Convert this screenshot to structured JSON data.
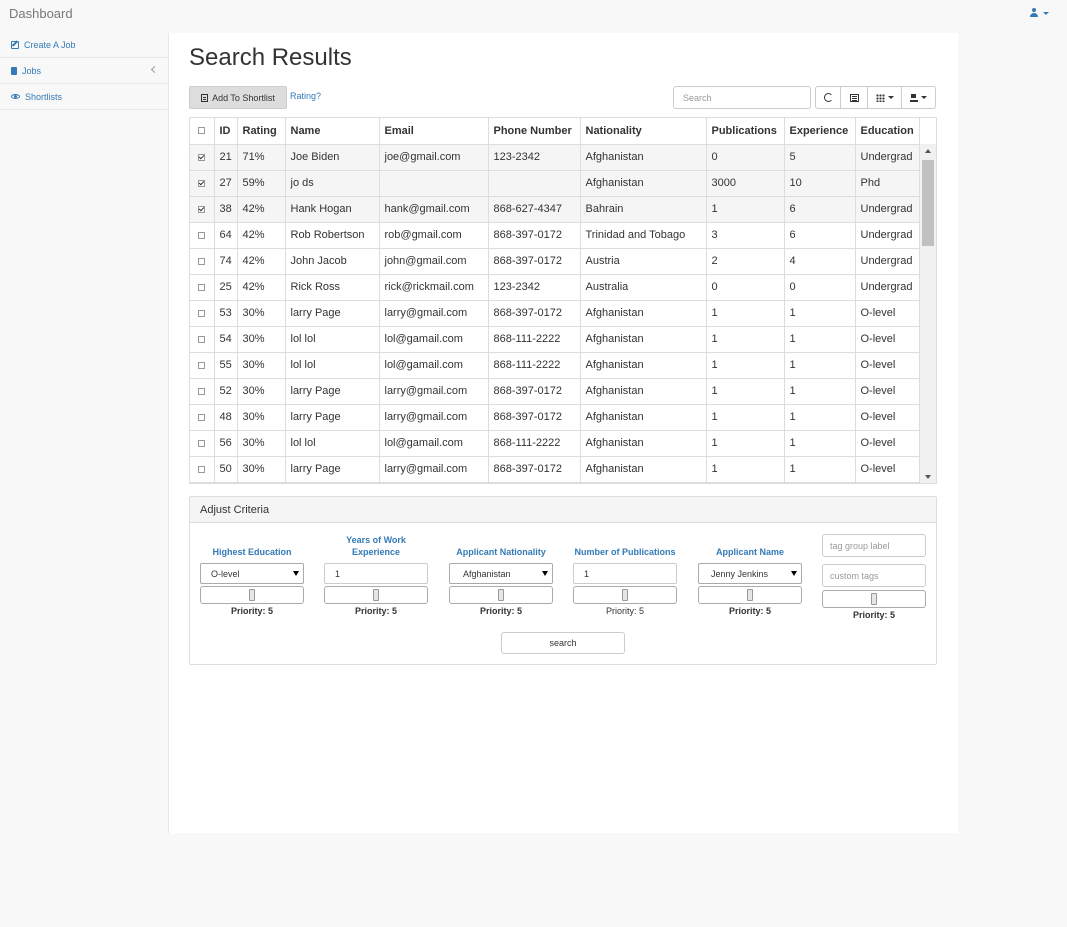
{
  "header": {
    "brand": "Dashboard",
    "user_icon": "user-icon"
  },
  "sidebar": {
    "items": [
      {
        "label": "Create A Job",
        "icon": "edit-icon"
      },
      {
        "label": "Jobs",
        "icon": "book-icon"
      },
      {
        "label": "Shortlists",
        "icon": "eye-icon"
      }
    ]
  },
  "page": {
    "title": "Search Results"
  },
  "toolbar": {
    "add_shortlist": "Add To Shortlist",
    "rating_link": "Rating?",
    "search_placeholder": "Search"
  },
  "table": {
    "columns": [
      "ID",
      "Rating",
      "Name",
      "Email",
      "Phone Number",
      "Nationality",
      "Publications",
      "Experience",
      "Education"
    ],
    "rows": [
      {
        "checked": true,
        "cells": [
          "21",
          "71%",
          "Joe Biden",
          "joe@gmail.com",
          "123-2342",
          "Afghanistan",
          "0",
          "5",
          "Undergrad"
        ]
      },
      {
        "checked": true,
        "cells": [
          "27",
          "59%",
          "jo ds",
          "",
          "",
          "Afghanistan",
          "3000",
          "10",
          "Phd"
        ]
      },
      {
        "checked": true,
        "cells": [
          "38",
          "42%",
          "Hank Hogan",
          "hank@gmail.com",
          "868-627-4347",
          "Bahrain",
          "1",
          "6",
          "Undergrad"
        ]
      },
      {
        "checked": false,
        "cells": [
          "64",
          "42%",
          "Rob Robertson",
          "rob@gmail.com",
          "868-397-0172",
          "Trinidad and Tobago",
          "3",
          "6",
          "Undergrad"
        ]
      },
      {
        "checked": false,
        "cells": [
          "74",
          "42%",
          "John Jacob",
          "john@gmail.com",
          "868-397-0172",
          "Austria",
          "2",
          "4",
          "Undergrad"
        ]
      },
      {
        "checked": false,
        "cells": [
          "25",
          "42%",
          "Rick Ross",
          "rick@rickmail.com",
          "123-2342",
          "Australia",
          "0",
          "0",
          "Undergrad"
        ]
      },
      {
        "checked": false,
        "cells": [
          "53",
          "30%",
          "larry Page",
          "larry@gmail.com",
          "868-397-0172",
          "Afghanistan",
          "1",
          "1",
          "O-level"
        ]
      },
      {
        "checked": false,
        "cells": [
          "54",
          "30%",
          "lol lol",
          "lol@gamail.com",
          "868-111-2222",
          "Afghanistan",
          "1",
          "1",
          "O-level"
        ]
      },
      {
        "checked": false,
        "cells": [
          "55",
          "30%",
          "lol lol",
          "lol@gamail.com",
          "868-111-2222",
          "Afghanistan",
          "1",
          "1",
          "O-level"
        ]
      },
      {
        "checked": false,
        "cells": [
          "52",
          "30%",
          "larry Page",
          "larry@gmail.com",
          "868-397-0172",
          "Afghanistan",
          "1",
          "1",
          "O-level"
        ]
      },
      {
        "checked": false,
        "cells": [
          "48",
          "30%",
          "larry Page",
          "larry@gmail.com",
          "868-397-0172",
          "Afghanistan",
          "1",
          "1",
          "O-level"
        ]
      },
      {
        "checked": false,
        "cells": [
          "56",
          "30%",
          "lol lol",
          "lol@gamail.com",
          "868-111-2222",
          "Afghanistan",
          "1",
          "1",
          "O-level"
        ]
      },
      {
        "checked": false,
        "cells": [
          "50",
          "30%",
          "larry Page",
          "larry@gmail.com",
          "868-397-0172",
          "Afghanistan",
          "1",
          "1",
          "O-level"
        ]
      }
    ]
  },
  "criteria": {
    "title": "Adjust Criteria",
    "education": {
      "label": "Highest Education",
      "value": "O-level",
      "priority": "Priority: 5"
    },
    "experience": {
      "label": "Years of Work Experience",
      "value": "1",
      "priority": "Priority: 5"
    },
    "nationality": {
      "label": "Applicant Nationality",
      "value": "Afghanistan",
      "priority": "Priority: 5"
    },
    "publications": {
      "label": "Number of Publications",
      "value": "1",
      "priority": "Priority: 5"
    },
    "name": {
      "label": "Applicant Name",
      "value": "Jenny Jenkins",
      "priority": "Priority: 5"
    },
    "tags": {
      "group_placeholder": "tag group label",
      "tags_placeholder": "custom tags",
      "priority": "Priority: 5"
    },
    "slider_level_fraction": 0.5,
    "search_button": "search"
  },
  "colors": {
    "link": "#337ab7",
    "selected_row": "#f5f5f5"
  }
}
